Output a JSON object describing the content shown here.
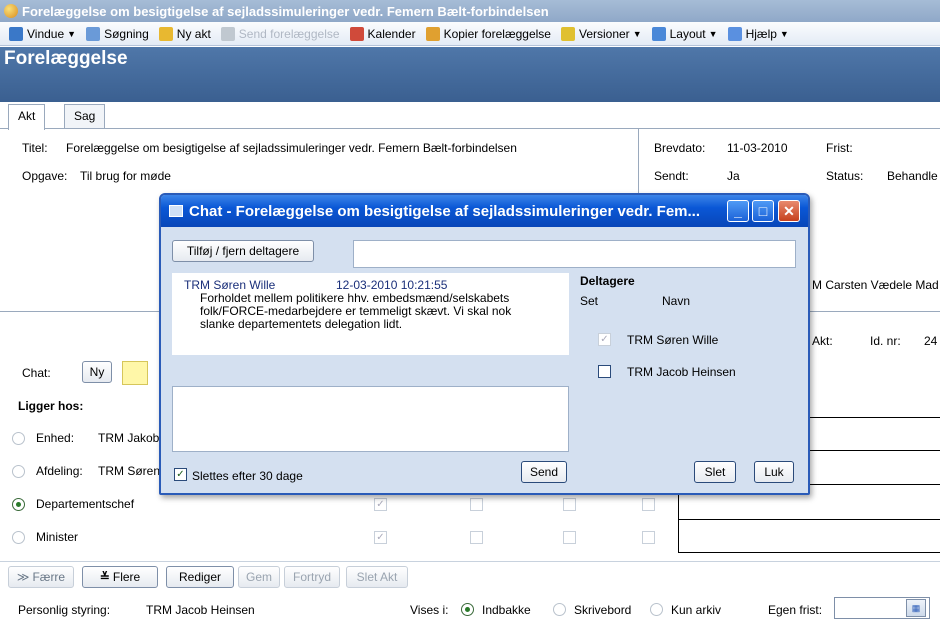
{
  "window": {
    "title": "Forelæggelse om besigtigelse af sejladssimuleringer vedr. Femern Bælt-forbindelsen"
  },
  "toolbar": {
    "items": [
      {
        "label": "Vindue",
        "icon": "window-icon",
        "dropdown": true,
        "enabled": true,
        "color": "#3a78c8"
      },
      {
        "label": "Søgning",
        "icon": "search-icon",
        "dropdown": false,
        "enabled": true,
        "color": "#6a9ad8"
      },
      {
        "label": "Ny akt",
        "icon": "new-document-icon",
        "dropdown": false,
        "enabled": true,
        "color": "#e8b830"
      },
      {
        "label": "Send forelæggelse",
        "icon": "send-icon",
        "dropdown": false,
        "enabled": false,
        "color": "#c0c8d0"
      },
      {
        "label": "Kalender",
        "icon": "calendar-icon",
        "dropdown": false,
        "enabled": true,
        "color": "#d04a3a"
      },
      {
        "label": "Kopier forelæggelse",
        "icon": "copy-icon",
        "dropdown": false,
        "enabled": true,
        "color": "#e0a030"
      },
      {
        "label": "Versioner",
        "icon": "versions-icon",
        "dropdown": true,
        "enabled": true,
        "color": "#e0c030"
      },
      {
        "label": "Layout",
        "icon": "layout-icon",
        "dropdown": true,
        "enabled": true,
        "color": "#4a88d8"
      },
      {
        "label": "Hjælp",
        "icon": "help-icon",
        "dropdown": true,
        "enabled": true,
        "color": "#5a90e0"
      }
    ]
  },
  "section": {
    "title": "Forelæggelse"
  },
  "tabs": [
    {
      "label": "Akt",
      "active": true
    },
    {
      "label": "Sag",
      "active": false
    }
  ],
  "fields": {
    "titel_label": "Titel:",
    "titel_value": "Forelæggelse om besigtigelse af sejladssimuleringer vedr. Femern Bælt-forbindelsen",
    "opgave_label": "Opgave:",
    "opgave_value": "Til brug for møde",
    "brevdato_label": "Brevdato:",
    "brevdato_value": "11-03-2010",
    "frist_label": "Frist:",
    "sendt_label": "Sendt:",
    "sendt_value": "Ja",
    "status_label": "Status:",
    "status_value": "Behandle",
    "person_partial": "M Carsten Vædele Mad",
    "akt_label": "Akt:",
    "idnr_label": "Id. nr:",
    "idnr_value": "24"
  },
  "chat_row": {
    "label": "Chat:",
    "new_button": "Ny"
  },
  "ligger_hos": {
    "heading": "Ligger hos:",
    "rows": [
      {
        "label": "Enhed:",
        "value": "TRM Jakob",
        "selected": false
      },
      {
        "label": "Afdeling:",
        "value": "TRM Søren",
        "selected": false
      },
      {
        "label": "Departementschef",
        "value": "",
        "selected": true
      },
      {
        "label": "Minister",
        "value": "",
        "selected": false
      }
    ]
  },
  "chat": {
    "title": "Chat - Forelæggelse om besigtigelse af sejladssimuleringer vedr. Fem...",
    "add_remove_button": "Tilføj / fjern deltagere",
    "subject_value": "",
    "message": {
      "author": "TRM Søren Wille",
      "timestamp": "12-03-2010 10:21:55",
      "text": "Forholdet mellem politikere hhv. embedsmænd/selskabets folk/FORCE-medarbejdere er temmeligt skævt. Vi skal nok slanke departementets delegation lidt."
    },
    "compose_value": "",
    "delete_after_30_label": "Slettes efter 30 dage",
    "delete_after_30_checked": true,
    "send_button": "Send",
    "participants_heading": "Deltagere",
    "col_set": "Set",
    "col_name": "Navn",
    "participants": [
      {
        "name": "TRM Søren Wille",
        "seen": true,
        "disabled": true
      },
      {
        "name": "TRM Jacob Heinsen",
        "seen": false,
        "disabled": false
      }
    ],
    "delete_button": "Slet",
    "close_button": "Luk"
  },
  "actions": {
    "fewer": "Færre",
    "more": "Flere",
    "edit": "Rediger",
    "save": "Gem",
    "undo": "Fortryd",
    "delete_akt": "Slet Akt"
  },
  "footer": {
    "personal_label": "Personlig styring:",
    "personal_value": "TRM Jacob Heinsen",
    "vises_label": "Vises i:",
    "options": [
      {
        "label": "Indbakke",
        "selected": true
      },
      {
        "label": "Skrivebord",
        "selected": false
      },
      {
        "label": "Kun arkiv",
        "selected": false
      }
    ],
    "own_deadline_label": "Egen frist:",
    "own_deadline_value": ""
  }
}
